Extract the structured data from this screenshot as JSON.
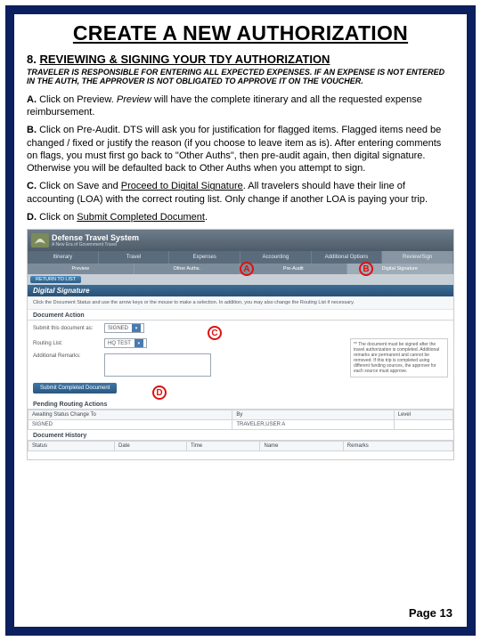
{
  "title": "CREATE A NEW AUTHORIZATION",
  "heading_number": "8.",
  "heading_text": "REVIEWING & SIGNING YOUR TDY AUTHORIZATION",
  "note": "TRAVELER IS RESPONSIBLE FOR ENTERING ALL EXPECTED EXPENSES. IF AN EXPENSE IS NOT ENTERED IN THE AUTH, THE APPROVER IS NOT OBLIGATED TO APPROVE IT ON THE VOUCHER.",
  "steps": {
    "a": {
      "label": "A.",
      "pre": "Click on Preview.  ",
      "italic": "Preview",
      "post": " will have the complete itinerary and all the requested expense reimbursement."
    },
    "b": {
      "label": "B.",
      "text": "Click on Pre-Audit. DTS will ask you for justification for flagged items. Flagged items need be changed / fixed or justify the reason (if you choose to leave item as is).  After entering comments on flags, you must first go back to \"Other Auths\", then pre-audit again, then digital signature.  Otherwise you will be defaulted back to Other Auths when you attempt to sign."
    },
    "c": {
      "label": "C.",
      "pre": "Click on Save and ",
      "underline": "Proceed to Digital Signature",
      "post": ".  All travelers should have their line of accounting (LOA) with the correct  routing list.  Only change if another LOA is paying your trip."
    },
    "d": {
      "label": "D.",
      "pre": "Click on ",
      "underline": "Submit Completed Document",
      "post": "."
    }
  },
  "dts": {
    "brand": "Defense Travel System",
    "tagline": "A New Era of Government Travel",
    "tabs": [
      "Itinerary",
      "Travel",
      "Expenses",
      "Accounting",
      "Additional Options",
      "Review/Sign"
    ],
    "subtabs": [
      "Preview",
      "Other Auths.",
      "Pre-Audit",
      "Digital Signature"
    ],
    "return_btn": "RETURN TO LIST",
    "digital_sig_title": "Digital Signature",
    "instruction": "Click the Document Status and use the arrow keys or the mouse to make a selection. In addition, you may also change the Routing List if necessary.",
    "panel1": "Document Action",
    "row1_label": "Submit this document as:",
    "row1_value": "SIGNED",
    "row2_label": "Routing List:",
    "row2_value": "HQ TEST",
    "row3_label": "Additional Remarks:",
    "sidenote": "** The document must be signed after the travel authorization is completed. Additional remarks are permanent and cannot be removed. If this trip is completed using different funding sources, the approver for each source must approve.",
    "submit_btn": "Submit Completed Document",
    "panel2": "Pending Routing Actions",
    "table2_headers": [
      "Awaiting Status Change To",
      "By",
      "Level"
    ],
    "table2_row": [
      "SIGNED",
      "TRAVELER,USER A",
      ""
    ],
    "panel3": "Document History",
    "table3_headers": [
      "Status",
      "Date",
      "Time",
      "Name",
      "Remarks"
    ]
  },
  "callouts": {
    "a": "A",
    "b": "B",
    "c": "C",
    "d": "D"
  },
  "page_number": "Page 13"
}
